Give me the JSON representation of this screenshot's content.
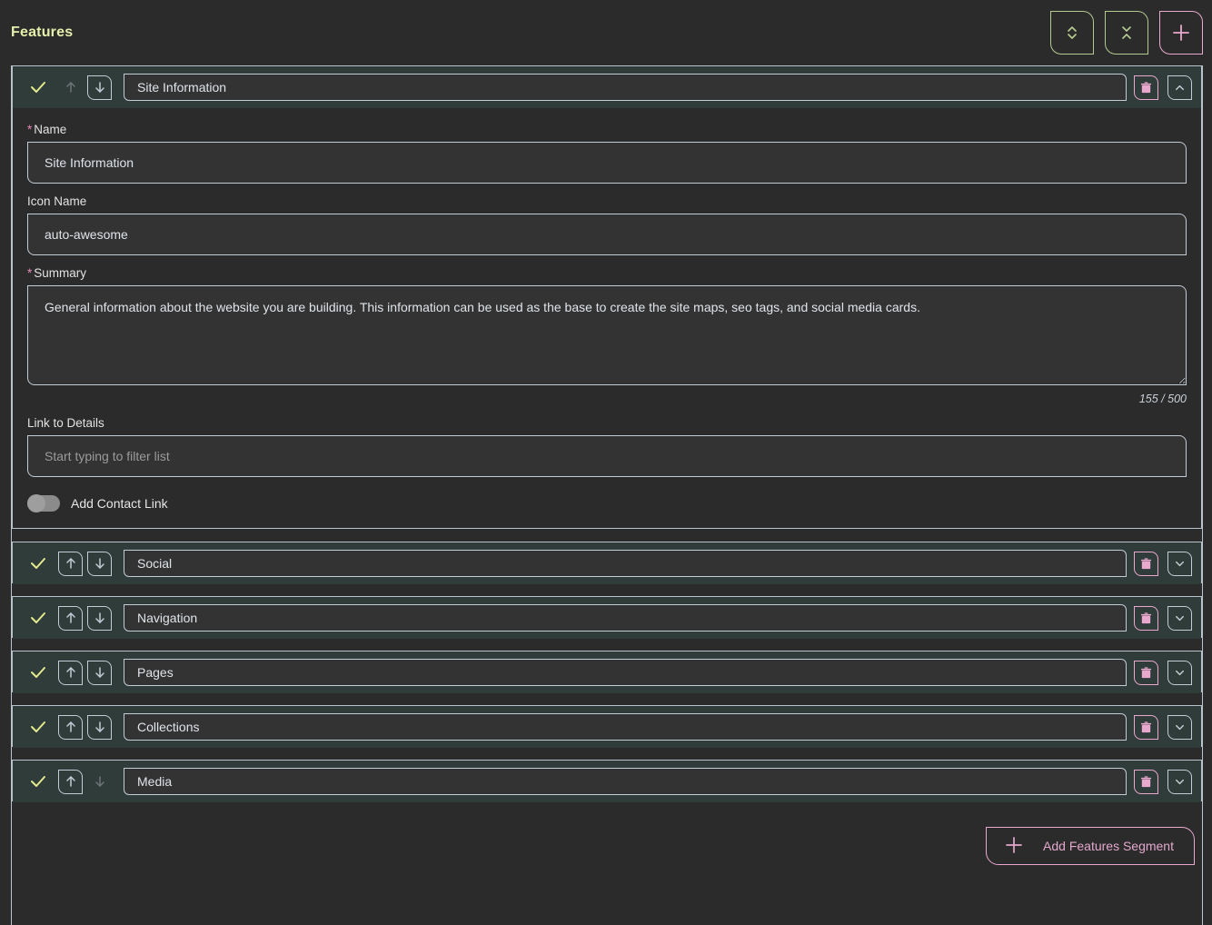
{
  "header": {
    "title": "Features",
    "actions": [
      {
        "name": "expand-all-button",
        "icon": "chevrons-expand-icon"
      },
      {
        "name": "collapse-all-button",
        "icon": "chevrons-collapse-icon"
      },
      {
        "name": "add-button",
        "icon": "plus-icon"
      }
    ]
  },
  "segments": [
    {
      "name_value": "Site Information",
      "expanded": true,
      "checked": true,
      "move_up_enabled": false,
      "move_down_enabled": true,
      "fields": {
        "name_label": "Name",
        "name_required": "*",
        "name_value": "Site Information",
        "icon_name_label": "Icon Name",
        "icon_name_value": "auto-awesome",
        "summary_label": "Summary",
        "summary_required": "*",
        "summary_value": "General information about the website you are building. This information can be used as the base to create the site maps, seo tags, and social media cards.",
        "summary_counter": "155 / 500",
        "link_label": "Link to Details",
        "link_value": "",
        "link_placeholder": "Start typing to filter list",
        "toggle_label": "Add Contact Link",
        "toggle_on": false
      }
    },
    {
      "name_value": "Social",
      "expanded": false,
      "checked": true,
      "move_up_enabled": true,
      "move_down_enabled": true
    },
    {
      "name_value": "Navigation",
      "expanded": false,
      "checked": true,
      "move_up_enabled": true,
      "move_down_enabled": true
    },
    {
      "name_value": "Pages",
      "expanded": false,
      "checked": true,
      "move_up_enabled": true,
      "move_down_enabled": true
    },
    {
      "name_value": "Collections",
      "expanded": false,
      "checked": true,
      "move_up_enabled": true,
      "move_down_enabled": true
    },
    {
      "name_value": "Media",
      "expanded": false,
      "checked": true,
      "move_up_enabled": true,
      "move_down_enabled": false
    }
  ],
  "footer": {
    "add_segment_label": "Add Features Segment",
    "add_segment_icon": "plus-icon"
  },
  "colors": {
    "accent_green": "#e6efab",
    "accent_pink": "#e9a8cd",
    "card_header_bg": "#2f3c3a",
    "page_bg": "#2b2b2b",
    "border": "#b9c3cc"
  }
}
